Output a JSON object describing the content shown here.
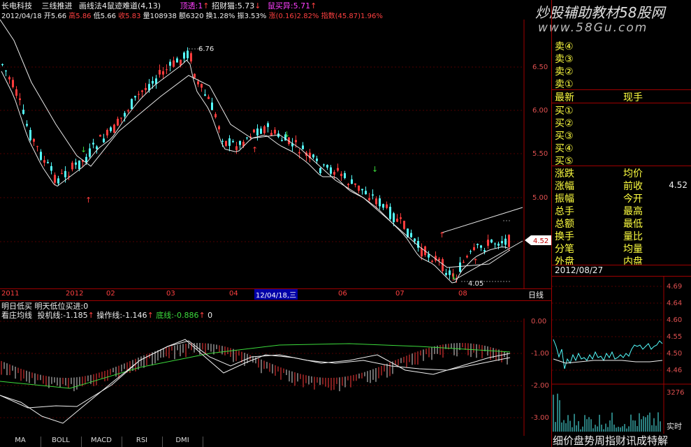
{
  "header": {
    "stock_name": "长电科技",
    "indicator_1": "三线推进",
    "indicator_2": "画线法4",
    "indicator_3": "鼠迹难道(4,13)",
    "sig_a_label": "顶透:1",
    "sig_b_label": "招财猫:5.73",
    "sig_c_label": "鼠买异:5.71",
    "date": "2012/04/18",
    "open": "开5.66",
    "high": "高5.86",
    "low": "低5.66",
    "close": "收5.83",
    "volume": "量108938",
    "amount": "额6320",
    "turnover": "换1.28%",
    "amplitude": "振3.53%",
    "change": "涨(0.16)2.82%",
    "index": "指数(45.87)1.96%"
  },
  "watermark": {
    "title": "炒股辅助教材58股网",
    "url": "www.58Gu.com"
  },
  "price_axis": [
    "6.50",
    "6.00",
    "5.50",
    "5.00",
    "4.50"
  ],
  "price_tag": "4.52",
  "annotations": {
    "high": "6.76",
    "low": "4.05"
  },
  "time_axis": [
    "2011",
    "2012",
    "02",
    "03",
    "04",
    "06",
    "07",
    "08"
  ],
  "cursor_date": "12/04/18,三",
  "period_label": "日线",
  "sub_panel": {
    "line1": "明日低买  明天低位买进:0",
    "label": "看庄均线",
    "invest": "投机线:-1.185",
    "operate": "操作线:-1.146",
    "base": "底线:-0.886",
    "tail": "0",
    "axis": [
      "0.00",
      "-1.00",
      "-2.00",
      "-3.00"
    ]
  },
  "tabs": [
    "MA",
    "BOLL",
    "MACD",
    "RSI",
    "DMI"
  ],
  "order_book": {
    "sells": [
      "卖④",
      "卖③",
      "卖②",
      "卖①"
    ],
    "latest_label": "最新",
    "now_label": "现手",
    "buys": [
      "买①",
      "买②",
      "买③",
      "买④",
      "买⑤"
    ]
  },
  "info": [
    {
      "l": "涨跌",
      "r": "均价",
      "v": ""
    },
    {
      "l": "涨幅",
      "r": "前收",
      "v": "4.52"
    },
    {
      "l": "振幅",
      "r": "今开",
      "v": ""
    },
    {
      "l": "总手",
      "r": "最高",
      "v": ""
    },
    {
      "l": "总额",
      "r": "最低",
      "v": ""
    },
    {
      "l": "换手",
      "r": "量比",
      "v": ""
    },
    {
      "l": "分笔",
      "r": "均量",
      "v": ""
    },
    {
      "l": "外盘",
      "r": "内盘",
      "v": ""
    }
  ],
  "mini_chart": {
    "date": "2012/08/27",
    "axis": [
      "4.69",
      "4.64",
      "4.60",
      "4.55",
      "4.50",
      "4.46"
    ],
    "vol": "3276",
    "realtime": "实时"
  },
  "footer": "细价盘势周指财讯成特解",
  "colors": {
    "up": "#ff3c3c",
    "down": "#54fcfc",
    "border": "#a00000",
    "ma": "#f0f0f0"
  }
}
